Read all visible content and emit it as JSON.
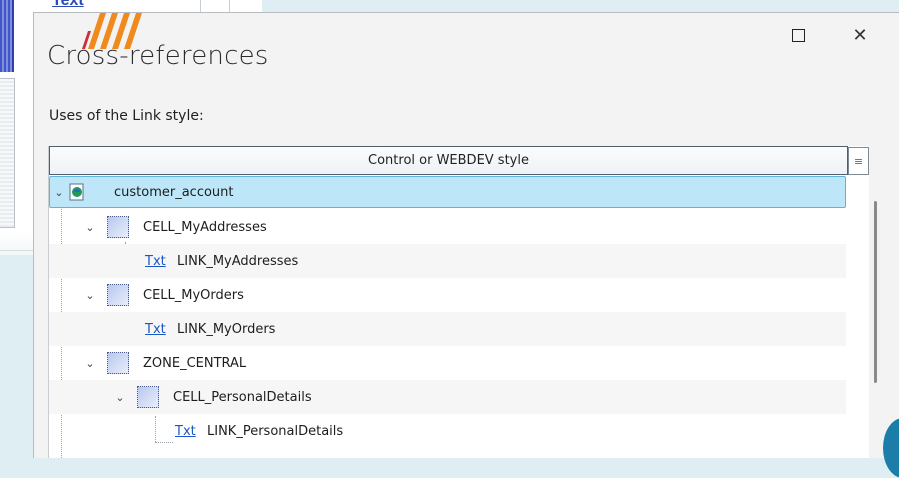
{
  "background_app": {
    "partial_text": "Text"
  },
  "dialog": {
    "title": "Cross-references",
    "subtitle": "Uses of the Link style:",
    "maximize_icon": "maximize-icon",
    "close_glyph": "✕"
  },
  "tree": {
    "column_header": "Control or WEBDEV style",
    "column_menu_glyph": "≡",
    "rows": [
      {
        "label": "customer_account",
        "icon": "project-icon",
        "selected": true
      },
      {
        "label": "CELL_MyAddresses",
        "icon": "cell-icon"
      },
      {
        "label": "LINK_MyAddresses",
        "icon": "link-text-icon",
        "prefix": "Txt"
      },
      {
        "label": "CELL_MyOrders",
        "icon": "cell-icon"
      },
      {
        "label": "LINK_MyOrders",
        "icon": "link-text-icon",
        "prefix": "Txt"
      },
      {
        "label": "ZONE_CENTRAL",
        "icon": "cell-icon"
      },
      {
        "label": "CELL_PersonalDetails",
        "icon": "cell-icon"
      },
      {
        "label": "LINK_PersonalDetails",
        "icon": "link-text-icon",
        "prefix": "Txt"
      }
    ]
  },
  "colors": {
    "selection_bg": "#bde7f8",
    "selection_border": "#5fb4da",
    "link_blue": "#1a56c9",
    "dialog_bg": "#f3f3f3"
  }
}
